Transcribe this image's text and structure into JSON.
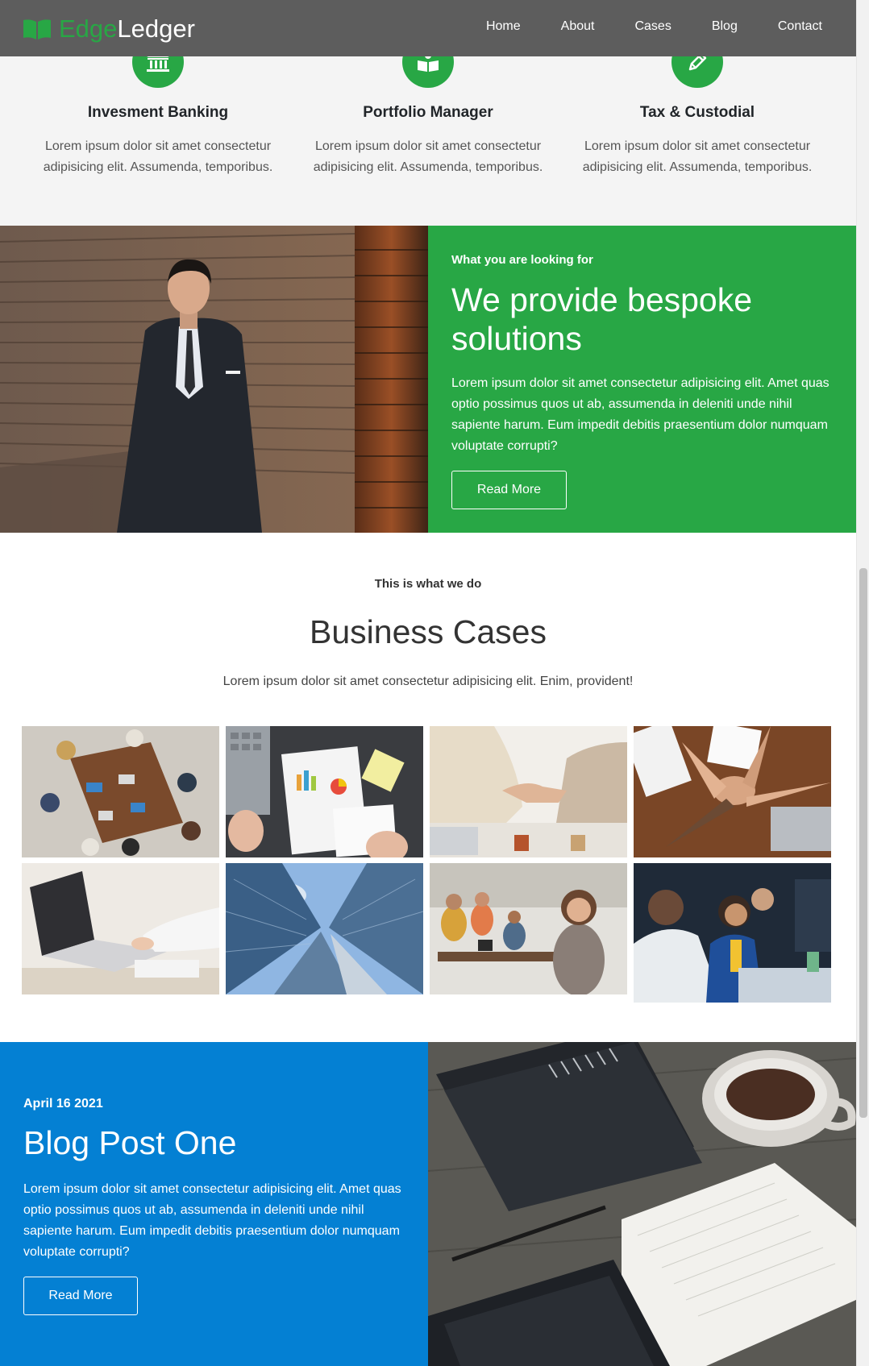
{
  "brand": {
    "part1": "Edge",
    "part2": "Ledger"
  },
  "nav": {
    "items": [
      "Home",
      "About",
      "Cases",
      "Blog",
      "Contact"
    ]
  },
  "services": [
    {
      "icon": "bank-icon",
      "title": "Invesment Banking",
      "text": "Lorem ipsum dolor sit amet consectetur adipisicing elit. Assumenda, temporibus."
    },
    {
      "icon": "book-icon",
      "title": "Portfolio Manager",
      "text": "Lorem ipsum dolor sit amet consectetur adipisicing elit. Assumenda, temporibus."
    },
    {
      "icon": "pencil-icon",
      "title": "Tax & Custodial",
      "text": "Lorem ipsum dolor sit amet consectetur adipisicing elit. Assumenda, temporibus."
    }
  ],
  "bespoke": {
    "eyebrow": "What you are looking for",
    "title": "We provide bespoke solutions",
    "text": "Lorem ipsum dolor sit amet consectetur adipisicing elit. Amet quas optio possimus quos ut ab, assumenda in deleniti unde nihil sapiente harum. Eum impedit debitis praesentium dolor numquam voluptate corrupti?",
    "button": "Read More"
  },
  "cases": {
    "eyebrow": "This is what we do",
    "title": "Business Cases",
    "subtitle": "Lorem ipsum dolor sit amet consectetur adipisicing elit. Enim, provident!"
  },
  "blog": {
    "date": "April 16 2021",
    "title": "Blog Post One",
    "text": "Lorem ipsum dolor sit amet consectetur adipisicing elit. Amet quas optio possimus quos ut ab, assumenda in deleniti unde nihil sapiente harum. Eum impedit debitis praesentium dolor numquam voluptate corrupti?",
    "button": "Read More"
  },
  "colors": {
    "green": "#28a745",
    "blue": "#0480d3",
    "navbar": "#5d5d5d",
    "services_bg": "#f4f4f4"
  }
}
